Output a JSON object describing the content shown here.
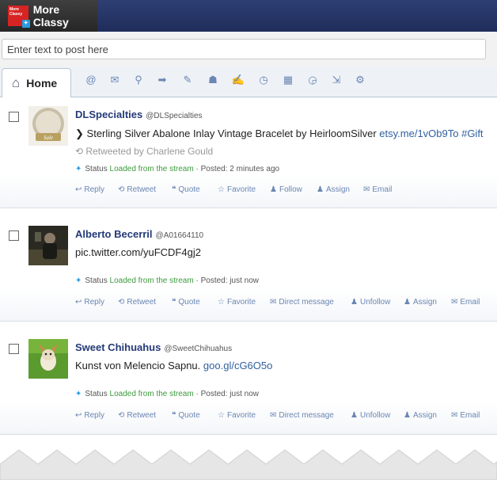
{
  "app": {
    "title": "More Classy",
    "logo_text": "More Classy"
  },
  "post": {
    "placeholder": "Enter text to post here"
  },
  "tabs": {
    "home_label": "Home"
  },
  "toolbar_icons": [
    "mention-icon",
    "direct-message-icon",
    "search-icon",
    "forward-icon",
    "tag-icon",
    "group-icon",
    "draft-icon",
    "clock-icon",
    "calendar-icon",
    "scheduled-icon",
    "export-icon",
    "settings-icon"
  ],
  "tweets": [
    {
      "name": "DLSpecialties",
      "handle": "@DLSpecialties",
      "text_main": "Sterling Silver Abalone Inlay Vintage Bracelet by HeirloomSilver",
      "text_link": "etsy.me/1vOb9To #Gift",
      "retweeted_by": "Retweeted by Charlene Gould",
      "status_label": "Status",
      "status_source": "Loaded from the stream",
      "posted_label": "· Posted:",
      "posted_time": "2 minutes ago",
      "actions": [
        "Reply",
        "Retweet",
        "Quote",
        "Favorite",
        "Follow",
        "Assign",
        "Email"
      ]
    },
    {
      "name": "Alberto Becerril",
      "handle": "@A01664110",
      "text_main": "",
      "text_link": "pic.twitter.com/yuFCDF4gj2",
      "status_label": "Status",
      "status_source": "Loaded from the stream",
      "posted_label": "· Posted:",
      "posted_time": "just now",
      "actions": [
        "Reply",
        "Retweet",
        "Quote",
        "Favorite",
        "Direct message",
        "Unfollow",
        "Assign",
        "Email"
      ]
    },
    {
      "name": "Sweet Chihuahus",
      "handle": "@SweetChihuahus",
      "text_main": "Kunst von Melencio Sapnu.",
      "text_link": "goo.gl/cG6O5o",
      "status_label": "Status",
      "status_source": "Loaded from the stream",
      "posted_label": "· Posted:",
      "posted_time": "just now",
      "actions": [
        "Reply",
        "Retweet",
        "Quote",
        "Favorite",
        "Direct message",
        "Unfollow",
        "Assign",
        "Email"
      ]
    }
  ],
  "avatar_text": {
    "t1": "Sale"
  },
  "colors": {
    "header": "#1f2d5a",
    "name": "#243a78",
    "link": "#2f5f9f",
    "stream": "#3c9a3c",
    "action": "#6a86b3"
  }
}
